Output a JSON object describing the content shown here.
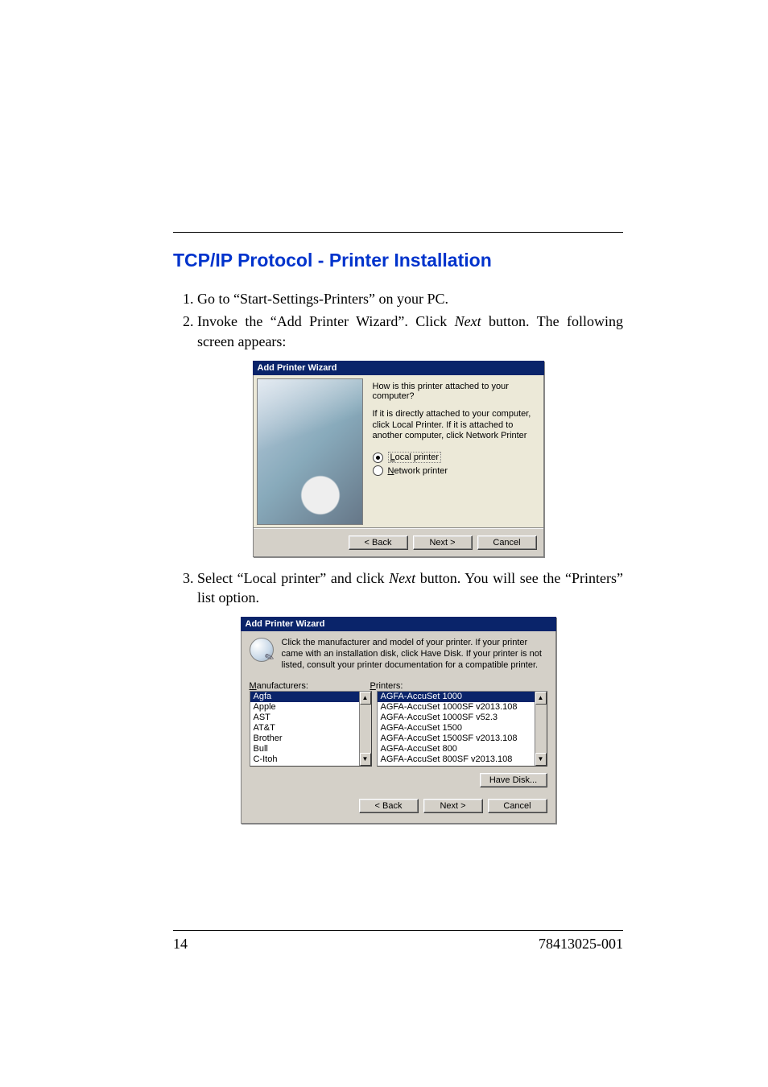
{
  "section_heading": "TCP/IP Protocol - Printer Installation",
  "steps": {
    "s1": "Go to “Start-Settings-Printers” on your PC.",
    "s2a": "Invoke the “Add Printer Wizard”. Click ",
    "s2b_italic": "Next",
    "s2c": " button. The following screen appears:",
    "s3a": "Select “Local printer” and click ",
    "s3b_italic": "Next",
    "s3c": " button. You will see the “Printers” list option."
  },
  "wizard1": {
    "title": "Add Printer Wizard",
    "question": "How is this printer attached to your computer?",
    "desc": "If it is directly attached to your computer, click Local Printer. If it is attached to another computer, click Network Printer",
    "opt_local_pre": "L",
    "opt_local_rest": "ocal printer",
    "opt_net_pre": "N",
    "opt_net_rest": "etwork printer",
    "back": "< Back",
    "next": "Next >",
    "cancel": "Cancel"
  },
  "wizard2": {
    "title": "Add Printer Wizard",
    "instructions": "Click the manufacturer and model of your printer. If your printer came with an installation disk, click Have Disk. If your printer is not listed, consult your printer documentation for a compatible printer.",
    "label_manu_u": "M",
    "label_manu_rest": "anufacturers:",
    "label_prn_u": "P",
    "label_prn_rest": "rinters:",
    "manufacturers": [
      "Agfa",
      "Apple",
      "AST",
      "AT&T",
      "Brother",
      "Bull",
      "C-Itoh"
    ],
    "printers": [
      "AGFA-AccuSet 1000",
      "AGFA-AccuSet 1000SF v2013.108",
      "AGFA-AccuSet 1000SF v52.3",
      "AGFA-AccuSet 1500",
      "AGFA-AccuSet 1500SF v2013.108",
      "AGFA-AccuSet 800",
      "AGFA-AccuSet 800SF v2013.108"
    ],
    "have_disk": "Have Disk...",
    "back": "< Back",
    "next": "Next >",
    "cancel": "Cancel"
  },
  "page_footer": {
    "page_num": "14",
    "doc_id": "78413025-001"
  }
}
